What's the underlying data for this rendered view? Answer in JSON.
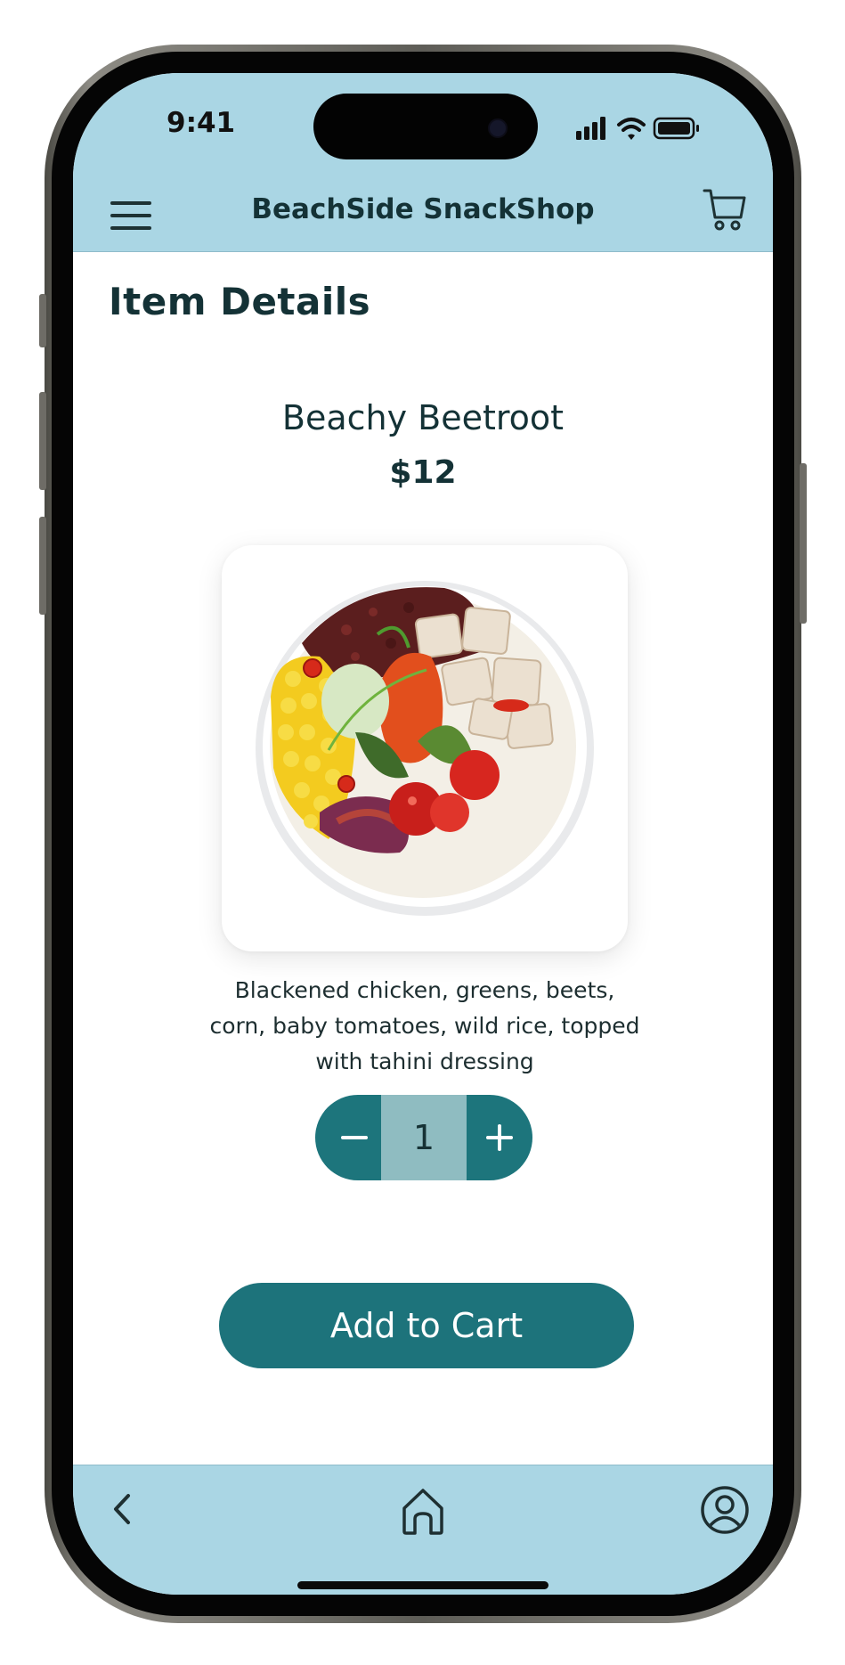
{
  "status_bar": {
    "time": "9:41",
    "icons": [
      "signal-icon",
      "wifi-icon",
      "battery-icon"
    ]
  },
  "header": {
    "title": "BeachSide SnackShop",
    "menu_icon": "hamburger-menu-icon",
    "cart_icon": "shopping-cart-icon"
  },
  "page": {
    "title": "Item Details"
  },
  "item": {
    "name": "Beachy Beetroot",
    "price": "$12",
    "image_alt": "food-bowl-image",
    "description": "Blackened chicken, greens, beets, corn, baby tomatoes, wild rice, topped with tahini dressing"
  },
  "quantity": {
    "value": "1",
    "decrement_icon": "minus-icon",
    "increment_icon": "plus-icon"
  },
  "actions": {
    "add_to_cart_label": "Add to Cart"
  },
  "bottom_nav": {
    "items": [
      "back-icon",
      "home-icon",
      "profile-icon"
    ]
  },
  "colors": {
    "header_bg": "#aad6e4",
    "accent": "#1d737b",
    "stepper_middle": "#8fbcc1",
    "text_dark": "#143236"
  }
}
